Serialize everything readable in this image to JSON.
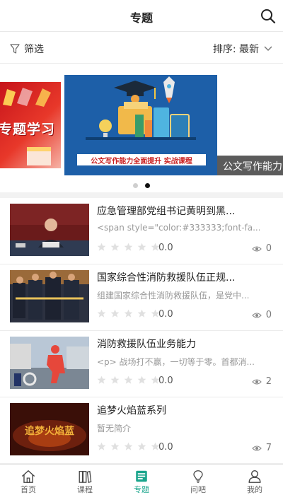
{
  "header": {
    "title": "专题"
  },
  "filterbar": {
    "filter_label": "筛选",
    "sort_label": "排序: 最新"
  },
  "banner": {
    "left_caption": "专题学习",
    "main_caption": "公文写作能力全面提升 实战课程",
    "right_caption": "公文写作能力",
    "slide_count": 2,
    "active_slide": 2
  },
  "items": [
    {
      "title": "应急管理部党组书记黄明到黑...",
      "desc": "<span style=\"color:#333333;font-fa...",
      "rating": 0,
      "score": "0.0",
      "views": "0"
    },
    {
      "title": "国家综合性消防救援队伍正规...",
      "desc": "组建国家综合性消防救援队伍，是党中...",
      "rating": 0,
      "score": "0.0",
      "views": "0"
    },
    {
      "title": "消防救援队伍业务能力",
      "desc": "<p> 战场打不赢，一切等于零。首都消...",
      "rating": 0,
      "score": "0.0",
      "views": "2"
    },
    {
      "title": "追梦火焰蓝系列",
      "desc": "暂无简介",
      "rating": 0,
      "score": "0.0",
      "views": "7"
    }
  ],
  "thumb_text": {
    "item4": "追梦火焰蓝"
  },
  "tabs": [
    {
      "label": "首页",
      "icon": "home-icon"
    },
    {
      "label": "课程",
      "icon": "book-icon"
    },
    {
      "label": "专题",
      "icon": "topic-icon",
      "active": true
    },
    {
      "label": "问吧",
      "icon": "lightbulb-icon"
    },
    {
      "label": "我的",
      "icon": "user-icon"
    }
  ],
  "colors": {
    "accent": "#1aa58c",
    "star": "#e0e0e0",
    "banner_blue": "#1d5fa8"
  }
}
